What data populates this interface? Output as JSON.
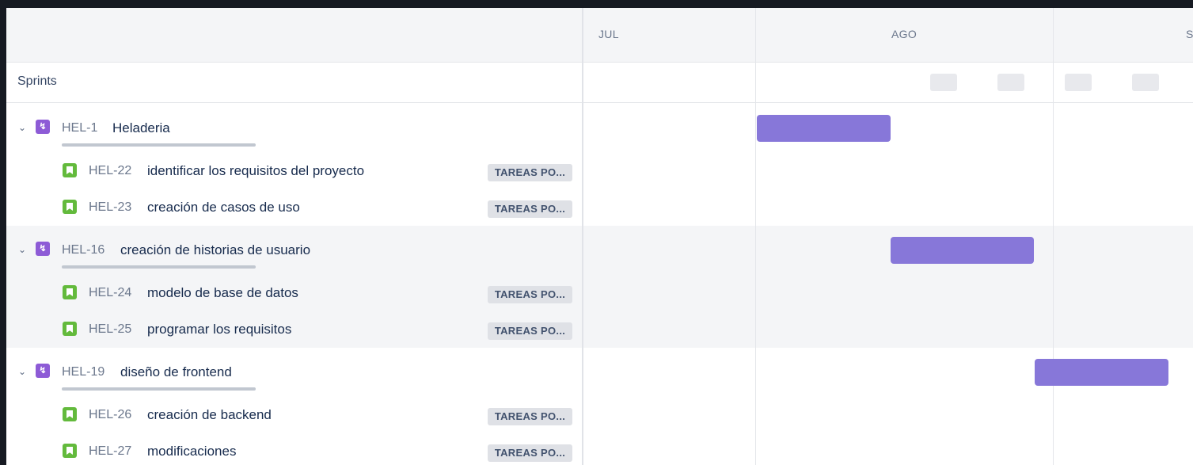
{
  "timeline": {
    "months": [
      "JUL",
      "AGO",
      "S"
    ],
    "sprints_label": "Sprints"
  },
  "epics": [
    {
      "key": "HEL-1",
      "title": "Heladeria",
      "icon": "epic-bolt-icon",
      "stories": [
        {
          "key": "HEL-22",
          "title": "identificar los requisitos del proyecto",
          "status": "TAREAS PO..."
        },
        {
          "key": "HEL-23",
          "title": "creación de casos de uso",
          "status": "TAREAS PO..."
        }
      ]
    },
    {
      "key": "HEL-16",
      "title": "creación de historias de usuario",
      "icon": "epic-bolt-icon",
      "stories": [
        {
          "key": "HEL-24",
          "title": "modelo de base de datos",
          "status": "TAREAS PO..."
        },
        {
          "key": "HEL-25",
          "title": "programar los requisitos",
          "status": "TAREAS PO..."
        }
      ]
    },
    {
      "key": "HEL-19",
      "title": "diseño de frontend",
      "icon": "epic-bolt-icon",
      "stories": [
        {
          "key": "HEL-26",
          "title": "creación de backend",
          "status": "TAREAS PO..."
        },
        {
          "key": "HEL-27",
          "title": "modificaciones",
          "status": "TAREAS PO..."
        }
      ]
    }
  ],
  "colors": {
    "epic_bar": "#8777d9",
    "epic_icon": "#8d5bd6",
    "story_icon": "#63ba3c",
    "status_badge": "#dfe1e6"
  }
}
